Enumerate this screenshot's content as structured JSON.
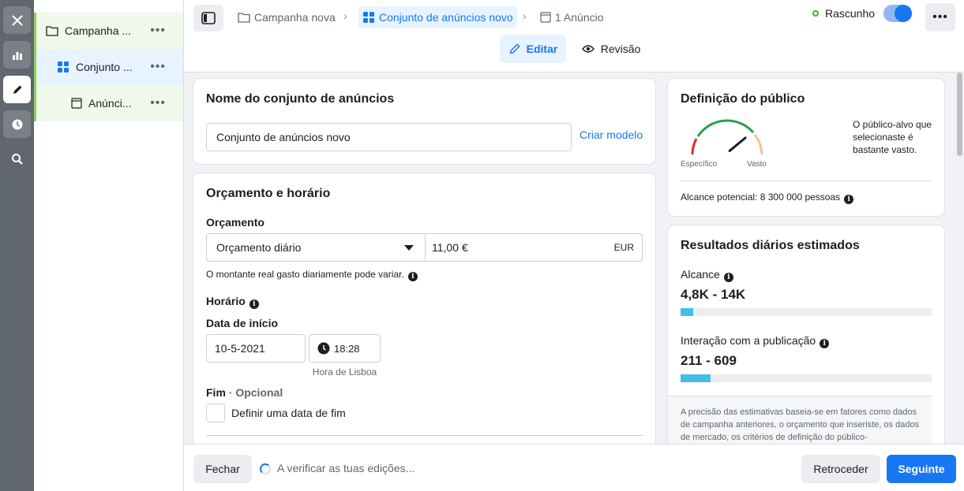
{
  "tree": {
    "items": [
      {
        "label": "Campanha ...",
        "icon": "folder-icon"
      },
      {
        "label": "Conjunto ...",
        "icon": "grid-icon"
      },
      {
        "label": "Anúnci...",
        "icon": "ad-icon"
      }
    ],
    "more": "•••"
  },
  "header": {
    "breadcrumbs": [
      "Campanha nova",
      "Conjunto de anúncios novo",
      "1 Anúncio"
    ],
    "status": "Rascunho",
    "more": "•••",
    "tabs": {
      "edit": "Editar",
      "review": "Revisão"
    }
  },
  "adset_name": {
    "title": "Nome do conjunto de anúncios",
    "value": "Conjunto de anúncios novo",
    "create_template": "Criar modelo"
  },
  "budget": {
    "title": "Orçamento e horário",
    "budget_label": "Orçamento",
    "budget_type": "Orçamento diário",
    "amount": "11,00 €",
    "currency": "EUR",
    "note": "O montante real gasto diariamente pode variar.",
    "schedule_label": "Horário",
    "start_label": "Data de início",
    "start_date": "10-5-2021",
    "start_time": "18:28",
    "timezone": "Hora de Lisboa",
    "end_label": "Fim",
    "end_optional": "· Opcional",
    "end_checkbox": "Definir uma data de fim"
  },
  "audience": {
    "title": "Definição do público",
    "gauge_left": "Específico",
    "gauge_right": "Vasto",
    "description": "O público-alvo que selecionaste é bastante vasto.",
    "potential_reach": "Alcance potencial: 8 300 000 pessoas",
    "gauge_level": 0.78
  },
  "estimates": {
    "title": "Resultados diários estimados",
    "reach_label": "Alcance",
    "reach_value": "4,8K - 14K",
    "reach_fill": 0.05,
    "engagement_label": "Interação com a publicação",
    "engagement_value": "211 - 609",
    "engagement_fill": 0.12,
    "disclaimer": "A precisão das estimativas baseia-se em fatores como dados de campanha anteriores, o orçamento que inseriste, os dados de mercado, os critérios de definição do público-"
  },
  "footer": {
    "close": "Fechar",
    "checking": "A verificar as tuas edições...",
    "back": "Retroceder",
    "next": "Seguinte"
  },
  "colors": {
    "accent": "#1877f2",
    "bar": "#45bde6",
    "status": "#42b72a"
  }
}
